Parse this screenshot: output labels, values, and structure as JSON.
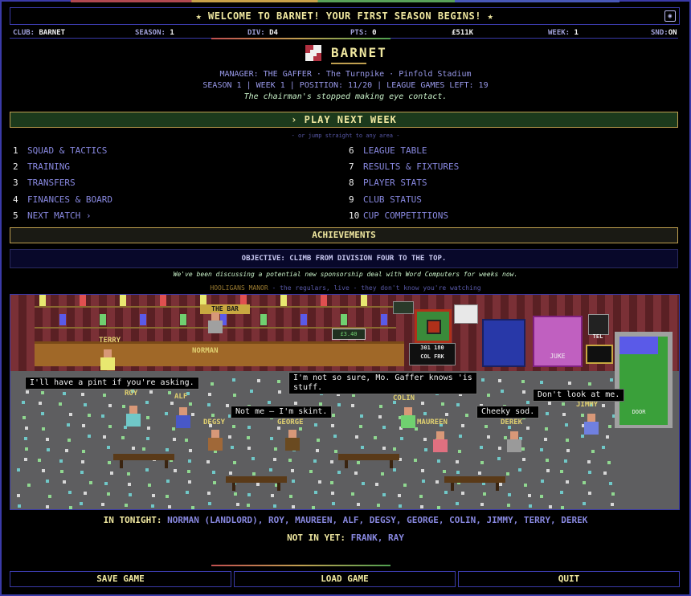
{
  "banner": {
    "text": "★ WELCOME TO BARNET! YOUR FIRST SEASON BEGINS! ★",
    "sound_icon": "sound-toggle-icon"
  },
  "status": {
    "club_label": "CLUB:",
    "club": "BARNET",
    "season_label": "SEASON:",
    "season": "1",
    "div_label": "DIV:",
    "div": "D4",
    "pts_label": "PTS:",
    "pts": "0",
    "money": "£511K",
    "week_label": "WEEK:",
    "week": "1",
    "snd_label": "SND:",
    "snd": "ON"
  },
  "club": {
    "name": "BARNET"
  },
  "info": {
    "line1": "MANAGER: THE GAFFER · The Turnpike · Pinfold Stadium",
    "line2": "SEASON 1 | WEEK 1 | POSITION: 11/20 | LEAGUE GAMES LEFT: 19",
    "line3": "The chairman's stopped making eye contact."
  },
  "play_button": "› PLAY NEXT WEEK",
  "jump_hint": "- or jump straight to any area -",
  "menu_left": [
    {
      "n": "1",
      "label": "SQUAD & TACTICS"
    },
    {
      "n": "2",
      "label": "TRAINING"
    },
    {
      "n": "3",
      "label": "TRANSFERS"
    },
    {
      "n": "4",
      "label": "FINANCES & BOARD"
    },
    {
      "n": "5",
      "label": "NEXT MATCH ›"
    }
  ],
  "menu_right": [
    {
      "n": "6",
      "label": "LEAGUE TABLE"
    },
    {
      "n": "7",
      "label": "RESULTS & FIXTURES"
    },
    {
      "n": "8",
      "label": "PLAYER STATS"
    },
    {
      "n": "9",
      "label": "CLUB STATUS"
    },
    {
      "n": "10",
      "label": "CUP COMPETITIONS"
    }
  ],
  "achievements_button": "ACHIEVEMENTS",
  "objective": "OBJECTIVE: CLIMB FROM DIVISION FOUR TO THE TOP.",
  "news": "We've been discussing a potential new sponsorship deal with Word Computers for weeks now.",
  "pub": {
    "title": "HOOLIGANS MANOR",
    "subtitle": "- the regulars, live - they don't know you're watching",
    "bar_label": "THE BAR",
    "price": "£3.40",
    "scoreboard_line1": "301 180",
    "scoreboard_line2": "COL FRK",
    "juke_label": "JUKE",
    "tel_label": "TEL",
    "door_label": "DOOR",
    "names": {
      "terry": "TERRY",
      "norman": "NORMAN",
      "roy": "ROY",
      "alf": "ALF",
      "degsy": "DEGSY",
      "george": "GEORGE",
      "colin": "COLIN",
      "maureen": "MAUREEN",
      "derek": "DEREK",
      "jimmy": "JIMMY"
    },
    "speech": {
      "pint": "I'll have a pint if you're asking.",
      "notsure": "I'm not so sure, Mo. Gaffer knows 'is\nstuff.",
      "skint": "Not me — I'm skint.",
      "cheeky": "Cheeky sod.",
      "dontlook": "Don't look at me."
    }
  },
  "in_tonight_label": "IN TONIGHT:",
  "in_tonight": "NORMAN (LANDLORD), ROY, MAUREEN, ALF, DEGSY, GEORGE, COLIN, JIMMY, TERRY, DEREK",
  "not_in_label": "NOT IN YET:",
  "not_in": "FRANK, RAY",
  "buttons": {
    "save": "SAVE GAME",
    "load": "LOAD GAME",
    "quit": "QUIT"
  },
  "colors": {
    "accent": "#f0e8a0",
    "menu": "#8888e0",
    "border": "#3a3aa8",
    "play_bg": "#1c3a1c"
  }
}
